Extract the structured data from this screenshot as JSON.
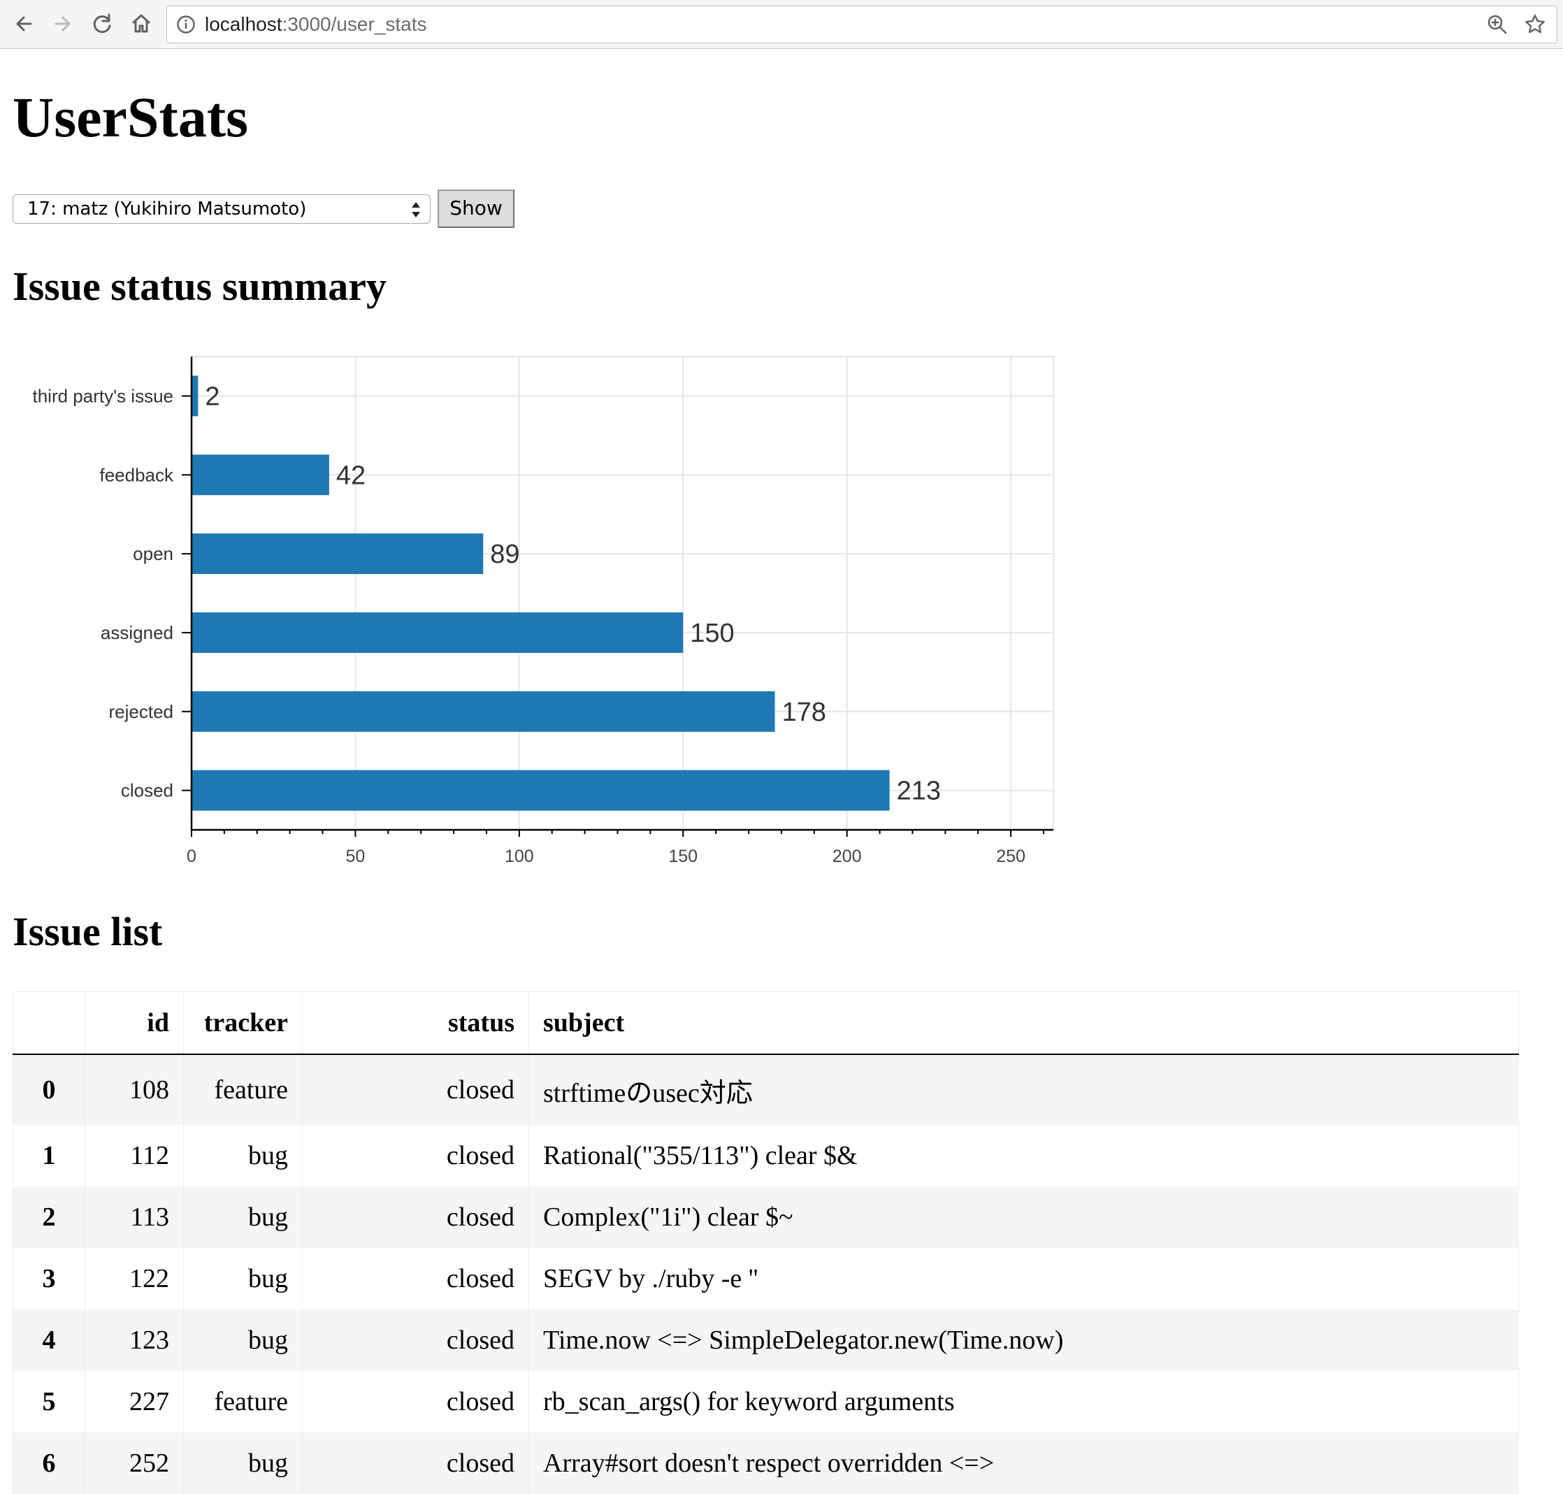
{
  "browser": {
    "url_host": "localhost",
    "url_path": ":3000/user_stats",
    "icons": [
      "back-icon",
      "forward-icon",
      "reload-icon",
      "home-icon",
      "info-icon",
      "zoom-icon",
      "star-icon"
    ]
  },
  "page": {
    "title": "UserStats",
    "user_select": {
      "value": "17: matz (Yukihiro Matsumoto)"
    },
    "show_button": "Show"
  },
  "summary": {
    "heading": "Issue status summary"
  },
  "chart_data": {
    "type": "bar",
    "orientation": "horizontal",
    "categories": [
      "third party's issue",
      "feedback",
      "open",
      "assigned",
      "rejected",
      "closed"
    ],
    "values": [
      2,
      42,
      89,
      150,
      178,
      213
    ],
    "xlim": [
      0,
      263
    ],
    "xticks": [
      0,
      50,
      100,
      150,
      200,
      250
    ],
    "grid": true,
    "bar_color": "#1f77b4"
  },
  "issue_list": {
    "heading": "Issue list",
    "columns": [
      "",
      "id",
      "tracker",
      "status",
      "subject"
    ],
    "rows": [
      {
        "index": "0",
        "id": "108",
        "tracker": "feature",
        "status": "closed",
        "subject": "strftimeのusec対応"
      },
      {
        "index": "1",
        "id": "112",
        "tracker": "bug",
        "status": "closed",
        "subject": "Rational(\"355/113\") clear $&"
      },
      {
        "index": "2",
        "id": "113",
        "tracker": "bug",
        "status": "closed",
        "subject": "Complex(\"1i\") clear $~"
      },
      {
        "index": "3",
        "id": "122",
        "tracker": "bug",
        "status": "closed",
        "subject": "SEGV by ./ruby -e ''"
      },
      {
        "index": "4",
        "id": "123",
        "tracker": "bug",
        "status": "closed",
        "subject": "Time.now <=> SimpleDelegator.new(Time.now)"
      },
      {
        "index": "5",
        "id": "227",
        "tracker": "feature",
        "status": "closed",
        "subject": "rb_scan_args() for keyword arguments"
      },
      {
        "index": "6",
        "id": "252",
        "tracker": "bug",
        "status": "closed",
        "subject": "Array#sort doesn't respect overridden <=>"
      }
    ]
  }
}
